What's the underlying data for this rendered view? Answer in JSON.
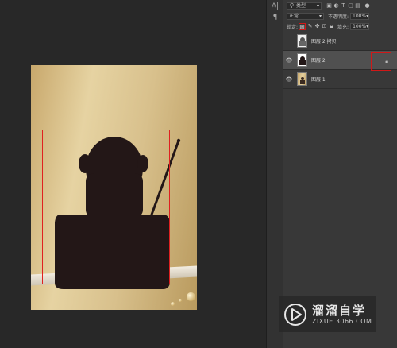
{
  "options_bar": {
    "filter_kind": "类型",
    "blend_mode": "正常",
    "opacity_label": "不透明度:",
    "opacity_value": "100%",
    "lock_label": "锁定:",
    "fill_label": "填充:",
    "fill_value": "100%"
  },
  "tools_strip": [
    "A|",
    "¶"
  ],
  "layers": [
    {
      "name": "图层 2 拷贝",
      "visible": false,
      "selected": false,
      "locked": false
    },
    {
      "name": "图层 2",
      "visible": true,
      "selected": true,
      "locked": true
    },
    {
      "name": "图层 1",
      "visible": true,
      "selected": false,
      "locked": false
    }
  ],
  "icons": {
    "eye": "eye-icon",
    "lock": "lock-icon",
    "lock_transparent": "lock-transparent-pixels-icon",
    "lock_paint": "lock-image-pixels-icon",
    "lock_move": "lock-position-icon",
    "lock_artboard": "lock-artboard-icon",
    "lock_all": "lock-all-icon"
  },
  "watermark": {
    "title": "溜溜自学",
    "url": "ZIXUE.3066.COM"
  },
  "colors": {
    "selection": "#e02020",
    "silhouette": "#231717",
    "panel_bg": "#383838",
    "workspace_bg": "#282828"
  }
}
